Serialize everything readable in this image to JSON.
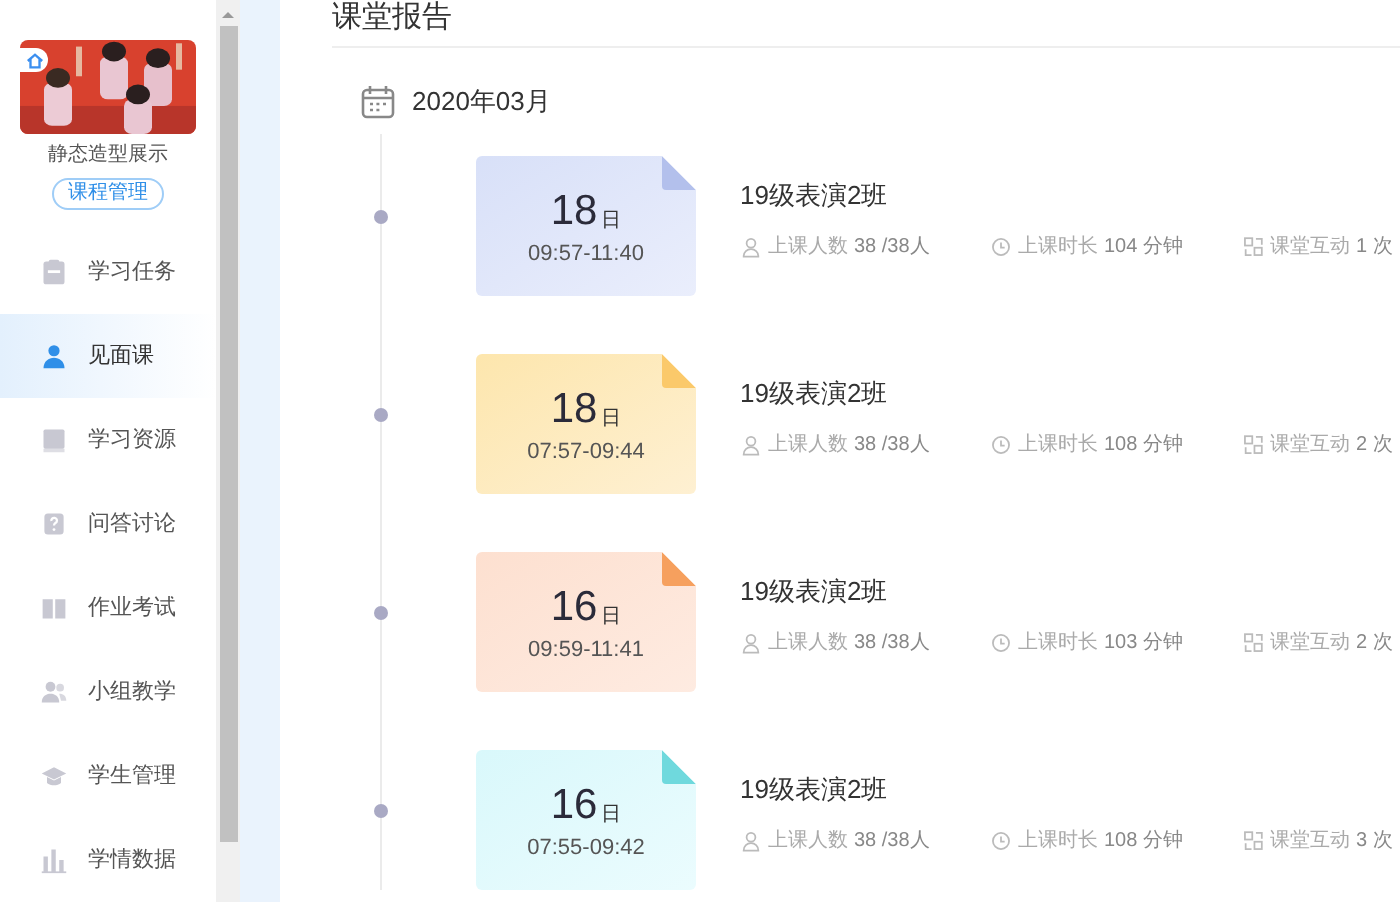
{
  "sidebar": {
    "course_name": "静态造型展示",
    "manage_button": "课程管理",
    "items": [
      {
        "label": "学习任务",
        "selected": false
      },
      {
        "label": "见面课",
        "selected": true
      },
      {
        "label": "学习资源",
        "selected": false
      },
      {
        "label": "问答讨论",
        "selected": false
      },
      {
        "label": "作业考试",
        "selected": false
      },
      {
        "label": "小组教学",
        "selected": false
      },
      {
        "label": "学生管理",
        "selected": false
      },
      {
        "label": "学情数据",
        "selected": false
      }
    ]
  },
  "page_title": "课堂报告",
  "month": "2020年03月",
  "sessions": [
    {
      "day": "18",
      "day_unit": "日",
      "time": "09:57-11:40",
      "color": "#b3c0ec",
      "class_name": "19级表演2班",
      "stats": [
        {
          "kind": "people",
          "label": "上课人数",
          "value": "38 /38人"
        },
        {
          "kind": "duration",
          "label": "上课时长",
          "value": "104 分钟"
        },
        {
          "kind": "interaction",
          "label": "课堂互动",
          "value": "1 次"
        }
      ]
    },
    {
      "day": "18",
      "day_unit": "日",
      "time": "07:57-09:44",
      "color": "#fbc96a",
      "class_name": "19级表演2班",
      "stats": [
        {
          "kind": "people",
          "label": "上课人数",
          "value": "38 /38人"
        },
        {
          "kind": "duration",
          "label": "上课时长",
          "value": "108 分钟"
        },
        {
          "kind": "interaction",
          "label": "课堂互动",
          "value": "2 次"
        }
      ]
    },
    {
      "day": "16",
      "day_unit": "日",
      "time": "09:59-11:41",
      "color": "#f6a05e",
      "class_name": "19级表演2班",
      "stats": [
        {
          "kind": "people",
          "label": "上课人数",
          "value": "38 /38人"
        },
        {
          "kind": "duration",
          "label": "上课时长",
          "value": "103 分钟"
        },
        {
          "kind": "interaction",
          "label": "课堂互动",
          "value": "2 次"
        }
      ]
    },
    {
      "day": "16",
      "day_unit": "日",
      "time": "07:55-09:42",
      "color": "#6fd9dd",
      "class_name": "19级表演2班",
      "stats": [
        {
          "kind": "people",
          "label": "上课人数",
          "value": "38 /38人"
        },
        {
          "kind": "duration",
          "label": "上课时长",
          "value": "108 分钟"
        },
        {
          "kind": "interaction",
          "label": "课堂互动",
          "value": "3 次"
        }
      ]
    }
  ]
}
